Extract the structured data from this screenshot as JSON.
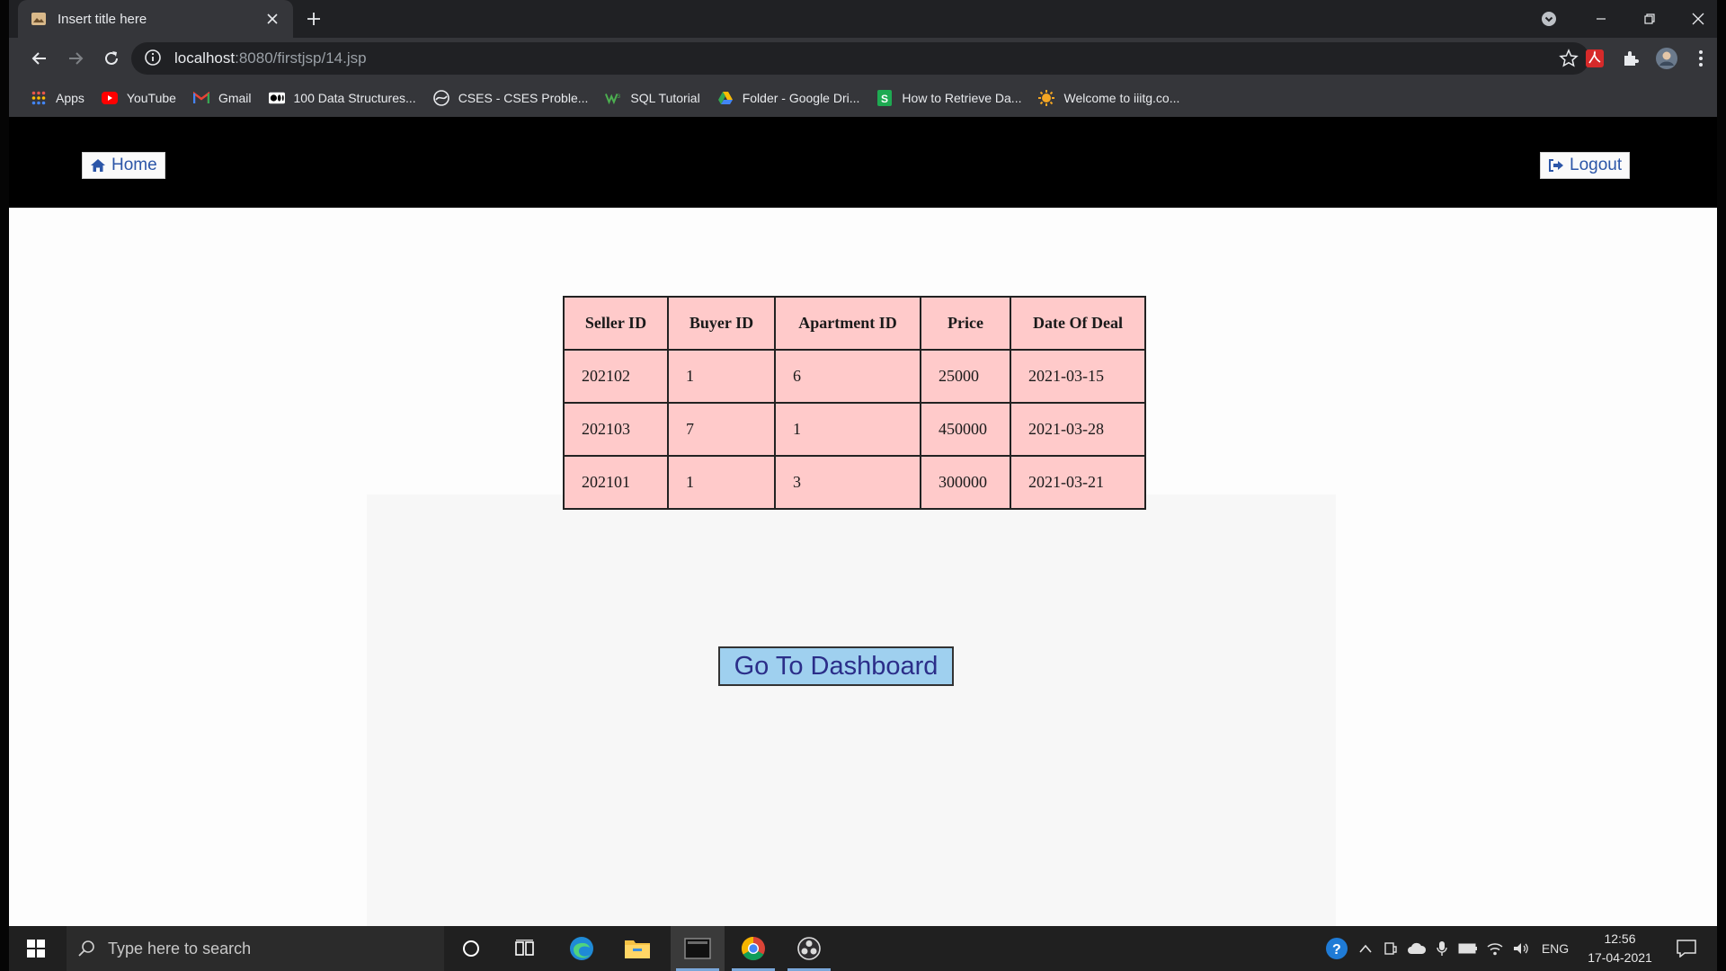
{
  "browser": {
    "tab_title": "Insert title here",
    "url_host": "localhost",
    "url_path": ":8080/firstjsp/14.jsp",
    "bookmarks": [
      {
        "label": "Apps",
        "icon": "apps-grid-icon"
      },
      {
        "label": "YouTube",
        "icon": "youtube-icon"
      },
      {
        "label": "Gmail",
        "icon": "gmail-icon"
      },
      {
        "label": "100 Data Structures...",
        "icon": "medium-icon"
      },
      {
        "label": "CSES - CSES Proble...",
        "icon": "cses-icon"
      },
      {
        "label": "SQL Tutorial",
        "icon": "w3schools-icon"
      },
      {
        "label": "Folder - Google Dri...",
        "icon": "google-drive-icon"
      },
      {
        "label": "How to Retrieve Da...",
        "icon": "sheets-icon"
      },
      {
        "label": "Welcome to iiitg.co...",
        "icon": "iiitg-icon"
      }
    ]
  },
  "header": {
    "home_label": "Home",
    "logout_label": "Logout"
  },
  "table": {
    "headers": [
      "Seller ID",
      "Buyer ID",
      "Apartment ID",
      "Price",
      "Date Of Deal"
    ],
    "rows": [
      [
        "202102",
        "1",
        "6",
        "25000",
        "2021-03-15"
      ],
      [
        "202103",
        "7",
        "1",
        "450000",
        "2021-03-28"
      ],
      [
        "202101",
        "1",
        "3",
        "300000",
        "2021-03-21"
      ]
    ]
  },
  "dashboard_button": "Go To Dashboard",
  "taskbar": {
    "search_placeholder": "Type here to search",
    "language": "ENG",
    "time": "12:56",
    "date": "17-04-2021"
  },
  "colors": {
    "table_cell_bg": "#ffcaca",
    "dashboard_button_bg": "#9fd0ef",
    "header_bg": "#000000"
  }
}
